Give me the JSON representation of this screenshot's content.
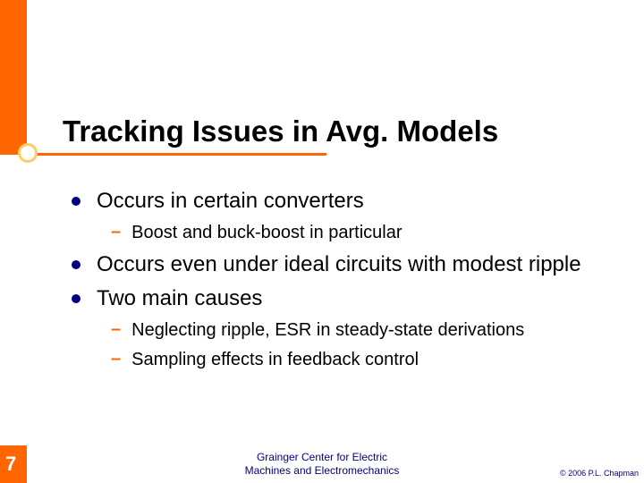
{
  "title": "Tracking Issues in Avg. Models",
  "bullets": {
    "b1": "Occurs in certain converters",
    "b1_1": "Boost and buck-boost in particular",
    "b2": "Occurs even under ideal circuits with modest ripple",
    "b3": "Two main causes",
    "b3_1": "Neglecting ripple, ESR in steady-state derivations",
    "b3_2": "Sampling effects in feedback control"
  },
  "page_number": "7",
  "footer": {
    "center_line1": "Grainger Center for Electric",
    "center_line2": "Machines and Electromechanics",
    "right": "© 2006 P.L. Chapman"
  }
}
